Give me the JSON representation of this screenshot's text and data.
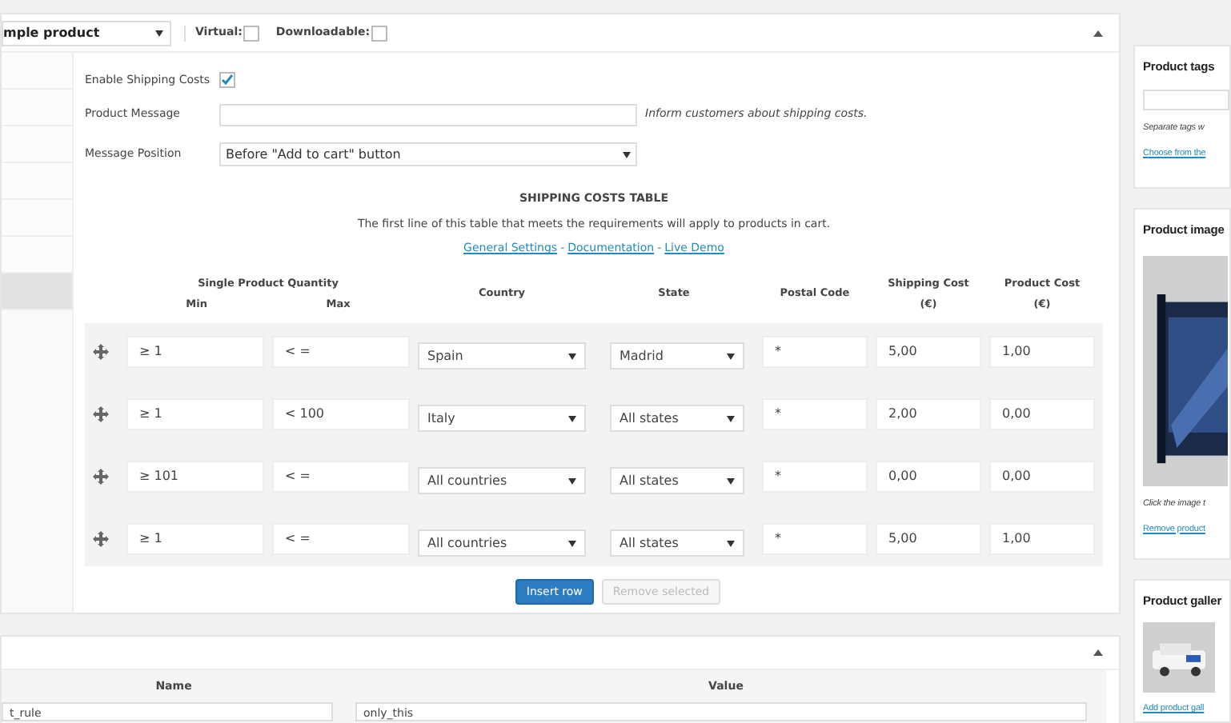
{
  "product_data": {
    "product_type": "mple product",
    "virtual": {
      "label": "Virtual:",
      "checked": false
    },
    "downloadable": {
      "label": "Downloadable:",
      "checked": false
    }
  },
  "sidebar_tabs": [
    {
      "selected": false
    },
    {
      "selected": false
    },
    {
      "selected": false
    },
    {
      "selected": false
    },
    {
      "selected": false
    },
    {
      "selected": false
    },
    {
      "selected": true
    }
  ],
  "settings": {
    "enable": {
      "label": "Enable Shipping Costs",
      "checked": true
    },
    "message": {
      "label": "Product Message",
      "hint": "Inform customers about shipping costs."
    },
    "position": {
      "label": "Message Position",
      "value": "Before \"Add to cart\" button"
    }
  },
  "table": {
    "title": "SHIPPING COSTS TABLE",
    "description": "The first line of this table that meets the requirements will apply to products in cart.",
    "links": [
      "General Settings",
      "Documentation",
      "Live Demo"
    ],
    "separator": "-",
    "group_heading": "Single Product Quantity",
    "columns": [
      "Min",
      "Max",
      "Country",
      "State",
      "Postal Code",
      "Shipping Cost",
      "Product Cost"
    ],
    "unit": "(€)",
    "rows": [
      {
        "min": "≥  1",
        "max": "<  =",
        "country": "Spain",
        "state": "Madrid",
        "postal": "*",
        "shipping": "5,00",
        "product": "1,00"
      },
      {
        "min": "≥  1",
        "max": "<  100",
        "country": "Italy",
        "state": "All states",
        "postal": "*",
        "shipping": "2,00",
        "product": "0,00"
      },
      {
        "min": "≥  101",
        "max": "<  =",
        "country": "All countries",
        "state": "All states",
        "postal": "*",
        "shipping": "0,00",
        "product": "0,00"
      },
      {
        "min": "≥  1",
        "max": "<  =",
        "country": "All countries",
        "state": "All states",
        "postal": "*",
        "shipping": "5,00",
        "product": "1,00"
      }
    ],
    "buttons": [
      {
        "label": "Insert row",
        "disabled": false
      },
      {
        "label": "Remove selected",
        "disabled": true
      }
    ]
  },
  "attributes": {
    "columns": [
      "Name",
      "Value"
    ],
    "name": "t_rule",
    "value": "only_this"
  },
  "sidebar": {
    "tags": {
      "title": "Product tags",
      "hint": "Separate tags w",
      "link": "Choose from the"
    },
    "image": {
      "title": "Product image",
      "hint": "Click the image t",
      "link": "Remove product"
    },
    "gallery": {
      "title": "Product galler",
      "link": "Add product gall"
    }
  }
}
